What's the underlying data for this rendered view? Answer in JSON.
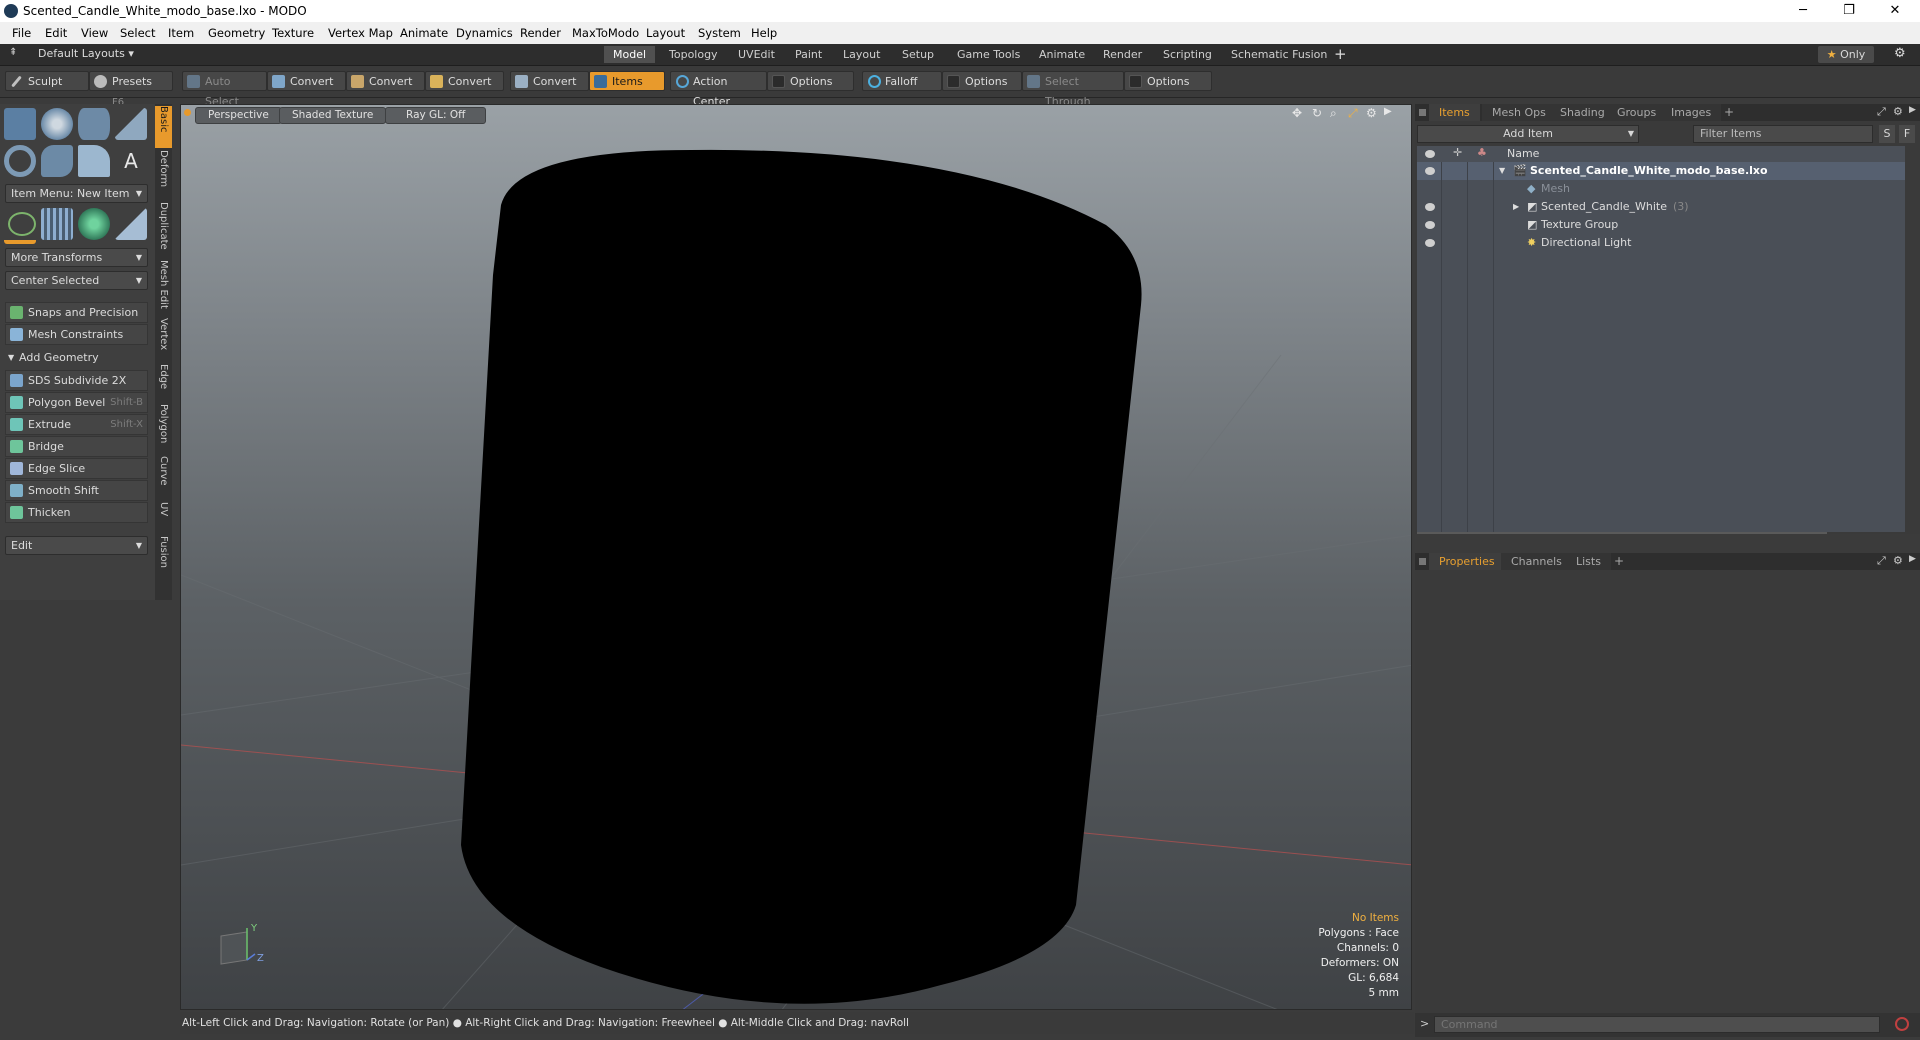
{
  "window": {
    "title": "Scented_Candle_White_modo_base.lxo - MODO",
    "minimize": "─",
    "restore": "❐",
    "close": "✕"
  },
  "menu": [
    "File",
    "Edit",
    "View",
    "Select",
    "Item",
    "Geometry",
    "Texture",
    "Vertex Map",
    "Animate",
    "Dynamics",
    "Render",
    "MaxToModo",
    "Layout",
    "System",
    "Help"
  ],
  "layouts": {
    "label": "Default Layouts",
    "tabs": [
      "Model",
      "Topology",
      "UVEdit",
      "Paint",
      "Layout",
      "Setup",
      "Game Tools",
      "Animate",
      "Render",
      "Scripting",
      "Schematic Fusion"
    ],
    "active_tab": "Model",
    "add": "+",
    "only": "Only",
    "star": "★"
  },
  "toolbar": {
    "sculpt": "Sculpt",
    "presets": "Presets",
    "presets_key": "F6",
    "auto_select": "Auto Select",
    "convert1": "Convert",
    "convert2": "Convert",
    "convert3": "Convert",
    "convert4": "Convert",
    "items": "Items",
    "action_center": "Action Center",
    "options1": "Options",
    "falloff": "Falloff",
    "options2": "Options",
    "select_through": "Select Through",
    "options3": "Options"
  },
  "left": {
    "vtabs": [
      "Basic",
      "Deform",
      "Duplicate",
      "Mesh Edit",
      "Vertex",
      "Edge",
      "Polygon",
      "Curve",
      "UV",
      "Fusion"
    ],
    "item_menu": "Item Menu: New Item",
    "more_transforms": "More Transforms",
    "center_selected": "Center Selected",
    "snaps": "Snaps and Precision",
    "constraints": "Mesh Constraints",
    "add_geometry": "Add Geometry",
    "tools": [
      {
        "label": "SDS Subdivide 2X",
        "key": ""
      },
      {
        "label": "Polygon Bevel",
        "key": "Shift-B"
      },
      {
        "label": "Extrude",
        "key": "Shift-X"
      },
      {
        "label": "Bridge",
        "key": ""
      },
      {
        "label": "Edge Slice",
        "key": ""
      },
      {
        "label": "Smooth Shift",
        "key": ""
      },
      {
        "label": "Thicken",
        "key": ""
      }
    ],
    "edit": "Edit"
  },
  "viewport": {
    "perspective": "Perspective",
    "shading": "Shaded Texture",
    "raygl": "Ray GL: Off",
    "info": {
      "items": "No Items",
      "polygons": "Polygons : Face",
      "channels": "Channels: 0",
      "deformers": "Deformers: ON",
      "gl": "GL: 6,684",
      "scale": "5 mm"
    },
    "axis_y": "Y",
    "axis_z": "Z"
  },
  "status": "Alt-Left Click and Drag: Navigation: Rotate (or Pan) ● Alt-Right Click and Drag: Navigation: Freewheel ● Alt-Middle Click and Drag: navRoll",
  "items_panel": {
    "tabs": [
      "Items",
      "Mesh Ops",
      "Shading",
      "Groups",
      "Images"
    ],
    "add_tab": "+",
    "add_item": "Add Item",
    "filter": "Filter Items",
    "btn_s": "S",
    "btn_f": "F",
    "col_name": "Name",
    "tree": [
      {
        "label": "Scented_Candle_White_modo_base.lxo",
        "count": ""
      },
      {
        "label": "Mesh",
        "count": ""
      },
      {
        "label": "Scented_Candle_White",
        "count": "(3)"
      },
      {
        "label": "Texture Group",
        "count": ""
      },
      {
        "label": "Directional Light",
        "count": ""
      }
    ]
  },
  "props_panel": {
    "tabs": [
      "Properties",
      "Channels",
      "Lists"
    ],
    "add_tab": "+"
  },
  "command": {
    "placeholder": "Command"
  }
}
